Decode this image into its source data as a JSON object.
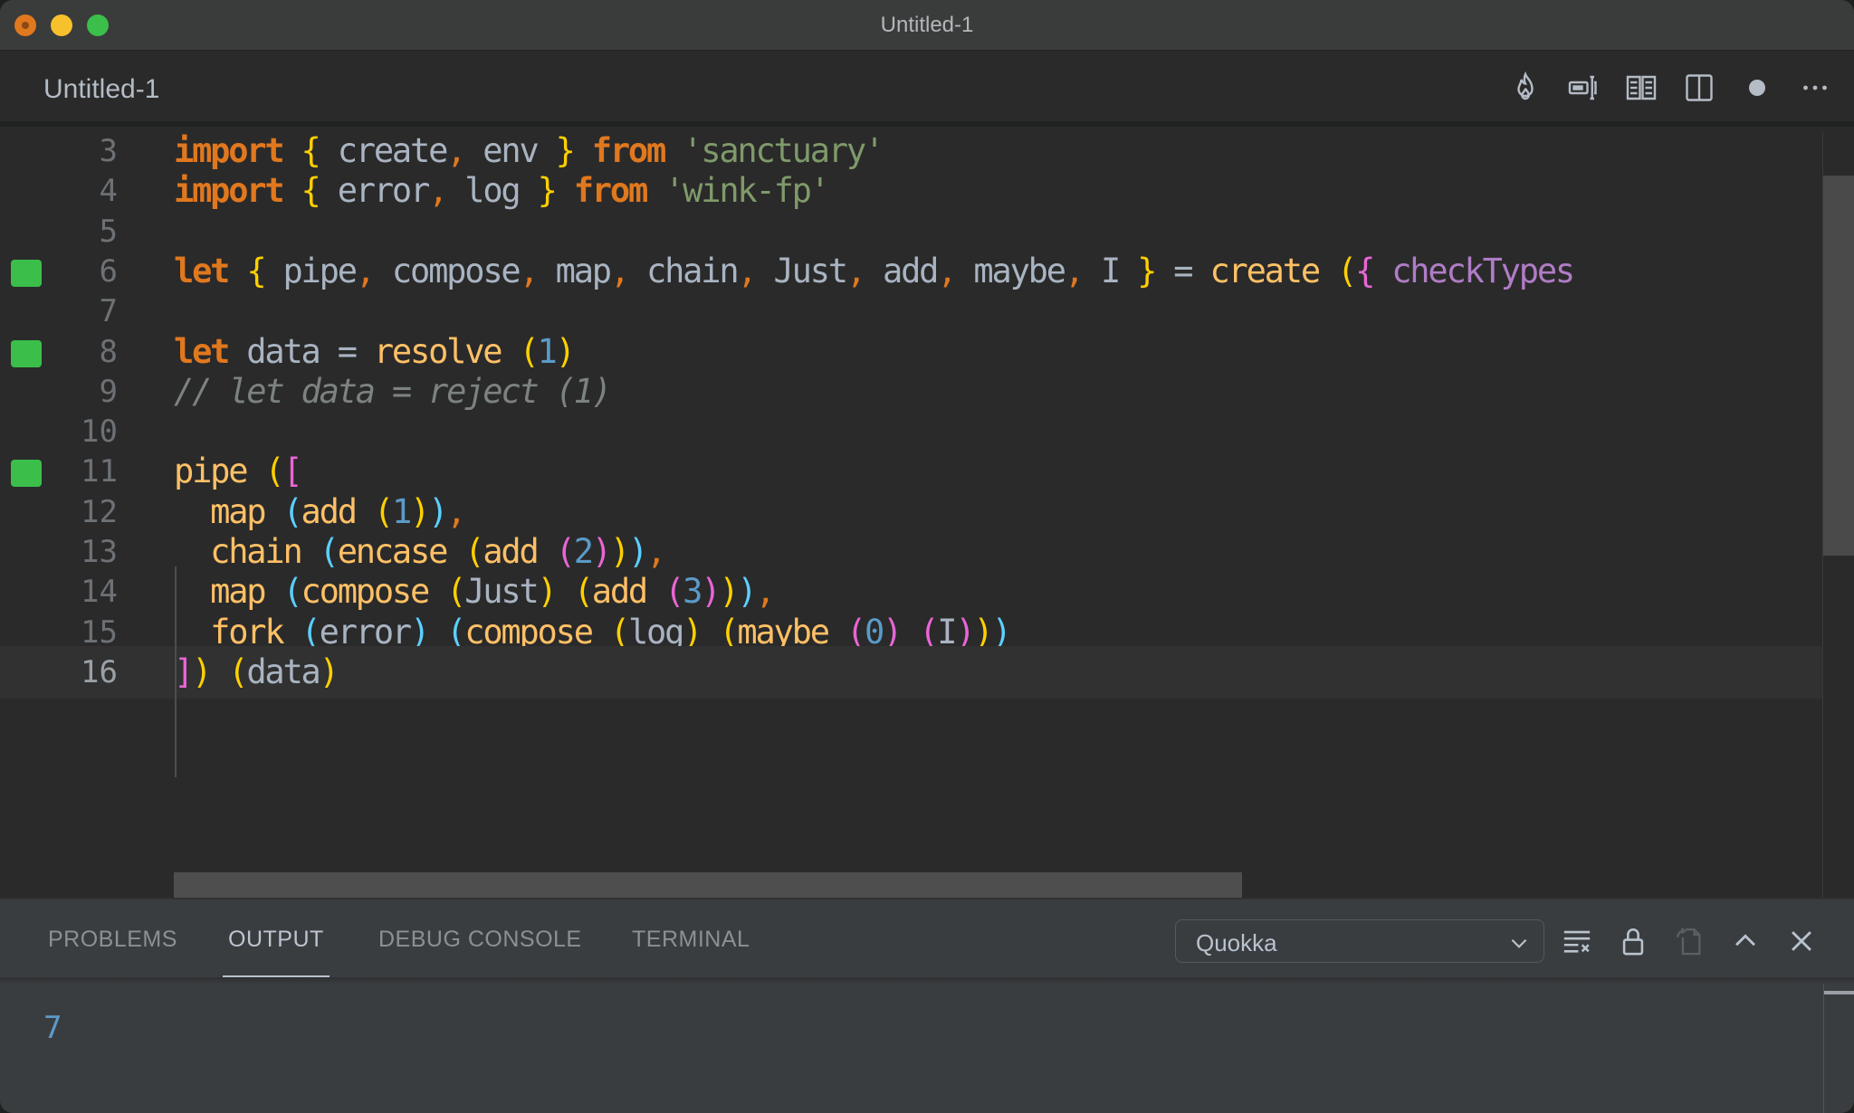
{
  "window": {
    "title": "Untitled-1",
    "traffic_lights": [
      "close",
      "minimize",
      "zoom"
    ]
  },
  "tabbar": {
    "active_tab": "Untitled-1",
    "actions": [
      {
        "name": "quokka-flame-icon"
      },
      {
        "name": "live-share-icon"
      },
      {
        "name": "open-preview-icon"
      },
      {
        "name": "split-editor-icon"
      },
      {
        "name": "unsaved-dot-icon"
      },
      {
        "name": "more-actions-icon"
      }
    ]
  },
  "editor": {
    "lines": [
      {
        "num": "3",
        "marker": false,
        "tokens": [
          [
            "kw",
            "import"
          ],
          [
            "id",
            " "
          ],
          [
            "p1",
            "{"
          ],
          [
            "id",
            " create"
          ],
          [
            "cmma",
            ","
          ],
          [
            "id",
            " env "
          ],
          [
            "p1",
            "}"
          ],
          [
            "id",
            " "
          ],
          [
            "kw",
            "from"
          ],
          [
            "id",
            " "
          ],
          [
            "str",
            "'sanctuary'"
          ]
        ]
      },
      {
        "num": "4",
        "marker": false,
        "tokens": [
          [
            "kw",
            "import"
          ],
          [
            "id",
            " "
          ],
          [
            "p1",
            "{"
          ],
          [
            "id",
            " error"
          ],
          [
            "cmma",
            ","
          ],
          [
            "id",
            " log "
          ],
          [
            "p1",
            "}"
          ],
          [
            "id",
            " "
          ],
          [
            "kw",
            "from"
          ],
          [
            "id",
            " "
          ],
          [
            "str",
            "'wink-fp'"
          ]
        ]
      },
      {
        "num": "5",
        "marker": false,
        "tokens": []
      },
      {
        "num": "6",
        "marker": true,
        "tokens": [
          [
            "kw",
            "let"
          ],
          [
            "id",
            " "
          ],
          [
            "p1",
            "{"
          ],
          [
            "id",
            " pipe"
          ],
          [
            "cmma",
            ","
          ],
          [
            "id",
            " compose"
          ],
          [
            "cmma",
            ","
          ],
          [
            "id",
            " map"
          ],
          [
            "cmma",
            ","
          ],
          [
            "id",
            " chain"
          ],
          [
            "cmma",
            ","
          ],
          [
            "id",
            " Just"
          ],
          [
            "cmma",
            ","
          ],
          [
            "id",
            " add"
          ],
          [
            "cmma",
            ","
          ],
          [
            "id",
            " maybe"
          ],
          [
            "cmma",
            ","
          ],
          [
            "id",
            " I "
          ],
          [
            "p1",
            "}"
          ],
          [
            "id",
            " = "
          ],
          [
            "fn",
            "create"
          ],
          [
            "id",
            " "
          ],
          [
            "p1",
            "("
          ],
          [
            "p2",
            "{"
          ],
          [
            "id",
            " "
          ],
          [
            "purple",
            "checkTypes"
          ]
        ]
      },
      {
        "num": "7",
        "marker": false,
        "tokens": []
      },
      {
        "num": "8",
        "marker": true,
        "tokens": [
          [
            "kw",
            "let"
          ],
          [
            "id",
            " data = "
          ],
          [
            "fn",
            "resolve"
          ],
          [
            "id",
            " "
          ],
          [
            "p1",
            "("
          ],
          [
            "num",
            "1"
          ],
          [
            "p1",
            ")"
          ]
        ]
      },
      {
        "num": "9",
        "marker": false,
        "tokens": [
          [
            "cm",
            "// let data = reject (1)"
          ]
        ]
      },
      {
        "num": "10",
        "marker": false,
        "tokens": []
      },
      {
        "num": "11",
        "marker": true,
        "tokens": [
          [
            "fn",
            "pipe"
          ],
          [
            "id",
            " "
          ],
          [
            "p1",
            "("
          ],
          [
            "p2",
            "["
          ]
        ]
      },
      {
        "num": "12",
        "marker": false,
        "tokens": [
          [
            "id",
            "  "
          ],
          [
            "fn",
            "map"
          ],
          [
            "id",
            " "
          ],
          [
            "p3",
            "("
          ],
          [
            "fn",
            "add"
          ],
          [
            "id",
            " "
          ],
          [
            "p1",
            "("
          ],
          [
            "num",
            "1"
          ],
          [
            "p1",
            ")"
          ],
          [
            "p3",
            ")"
          ],
          [
            "cmma",
            ","
          ]
        ]
      },
      {
        "num": "13",
        "marker": false,
        "tokens": [
          [
            "id",
            "  "
          ],
          [
            "fn",
            "chain"
          ],
          [
            "id",
            " "
          ],
          [
            "p3",
            "("
          ],
          [
            "fn",
            "encase"
          ],
          [
            "id",
            " "
          ],
          [
            "p1",
            "("
          ],
          [
            "fn",
            "add"
          ],
          [
            "id",
            " "
          ],
          [
            "p2",
            "("
          ],
          [
            "num",
            "2"
          ],
          [
            "p2",
            ")"
          ],
          [
            "p1",
            ")"
          ],
          [
            "p3",
            ")"
          ],
          [
            "cmma",
            ","
          ]
        ]
      },
      {
        "num": "14",
        "marker": false,
        "tokens": [
          [
            "id",
            "  "
          ],
          [
            "fn",
            "map"
          ],
          [
            "id",
            " "
          ],
          [
            "p3",
            "("
          ],
          [
            "fn",
            "compose"
          ],
          [
            "id",
            " "
          ],
          [
            "p1",
            "("
          ],
          [
            "id",
            "Just"
          ],
          [
            "p1",
            ")"
          ],
          [
            "id",
            " "
          ],
          [
            "p1",
            "("
          ],
          [
            "fn",
            "add"
          ],
          [
            "id",
            " "
          ],
          [
            "p2",
            "("
          ],
          [
            "num",
            "3"
          ],
          [
            "p2",
            ")"
          ],
          [
            "p1",
            ")"
          ],
          [
            "p3",
            ")"
          ],
          [
            "cmma",
            ","
          ]
        ]
      },
      {
        "num": "15",
        "marker": false,
        "tokens": [
          [
            "id",
            "  "
          ],
          [
            "fn",
            "fork"
          ],
          [
            "id",
            " "
          ],
          [
            "p3",
            "("
          ],
          [
            "id",
            "error"
          ],
          [
            "p3",
            ")"
          ],
          [
            "id",
            " "
          ],
          [
            "p3",
            "("
          ],
          [
            "fn",
            "compose"
          ],
          [
            "id",
            " "
          ],
          [
            "p1",
            "("
          ],
          [
            "id",
            "log"
          ],
          [
            "p1",
            ")"
          ],
          [
            "id",
            " "
          ],
          [
            "p1",
            "("
          ],
          [
            "fn",
            "maybe"
          ],
          [
            "id",
            " "
          ],
          [
            "p2",
            "("
          ],
          [
            "num",
            "0"
          ],
          [
            "p2",
            ")"
          ],
          [
            "id",
            " "
          ],
          [
            "p2",
            "("
          ],
          [
            "id",
            "I"
          ],
          [
            "p2",
            ")"
          ],
          [
            "p1",
            ")"
          ],
          [
            "p3",
            ")"
          ]
        ]
      },
      {
        "num": "16",
        "marker": false,
        "current": true,
        "tokens": [
          [
            "p2",
            "]"
          ],
          [
            "p1",
            ")"
          ],
          [
            "id",
            " "
          ],
          [
            "p1",
            "("
          ],
          [
            "id",
            "data"
          ],
          [
            "p1",
            ")"
          ]
        ]
      }
    ]
  },
  "panel": {
    "tabs": [
      {
        "label": "PROBLEMS",
        "active": false
      },
      {
        "label": "OUTPUT",
        "active": true
      },
      {
        "label": "DEBUG CONSOLE",
        "active": false
      },
      {
        "label": "TERMINAL",
        "active": false
      }
    ],
    "output_channel": "Quokka",
    "actions": [
      {
        "name": "clear-output-icon"
      },
      {
        "name": "lock-scroll-icon"
      },
      {
        "name": "open-log-file-icon"
      },
      {
        "name": "maximize-panel-icon"
      },
      {
        "name": "close-panel-icon"
      }
    ],
    "output": "7"
  },
  "colors": {
    "keyword": "#e0781e",
    "identifier": "#a9b4c2",
    "function": "#ffc066",
    "string": "#7f9a6a",
    "number": "#5a9bc8",
    "comment": "#7c8280",
    "bracket1": "#ffd000",
    "bracket2": "#e866d6",
    "bracket3": "#5ccfff",
    "coverage_marker": "#3bbe4a"
  }
}
